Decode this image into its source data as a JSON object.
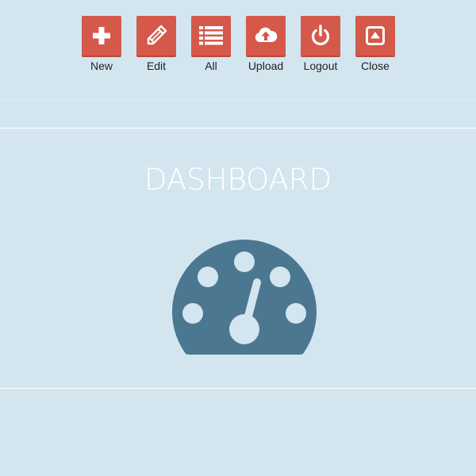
{
  "colors": {
    "background": "#d3e6f0",
    "button": "#d5594a",
    "gauge": "#4b7791",
    "divider": "#ffffff"
  },
  "toolbar": {
    "items": [
      {
        "label": "New",
        "icon": "plus-icon"
      },
      {
        "label": "Edit",
        "icon": "pencil-icon"
      },
      {
        "label": "All",
        "icon": "list-icon"
      },
      {
        "label": "Upload",
        "icon": "cloud-upload-icon"
      },
      {
        "label": "Logout",
        "icon": "power-icon"
      },
      {
        "label": "Close",
        "icon": "eject-icon"
      }
    ]
  },
  "main": {
    "title": "DASHBOARD",
    "icon": "dashboard-gauge-icon"
  }
}
